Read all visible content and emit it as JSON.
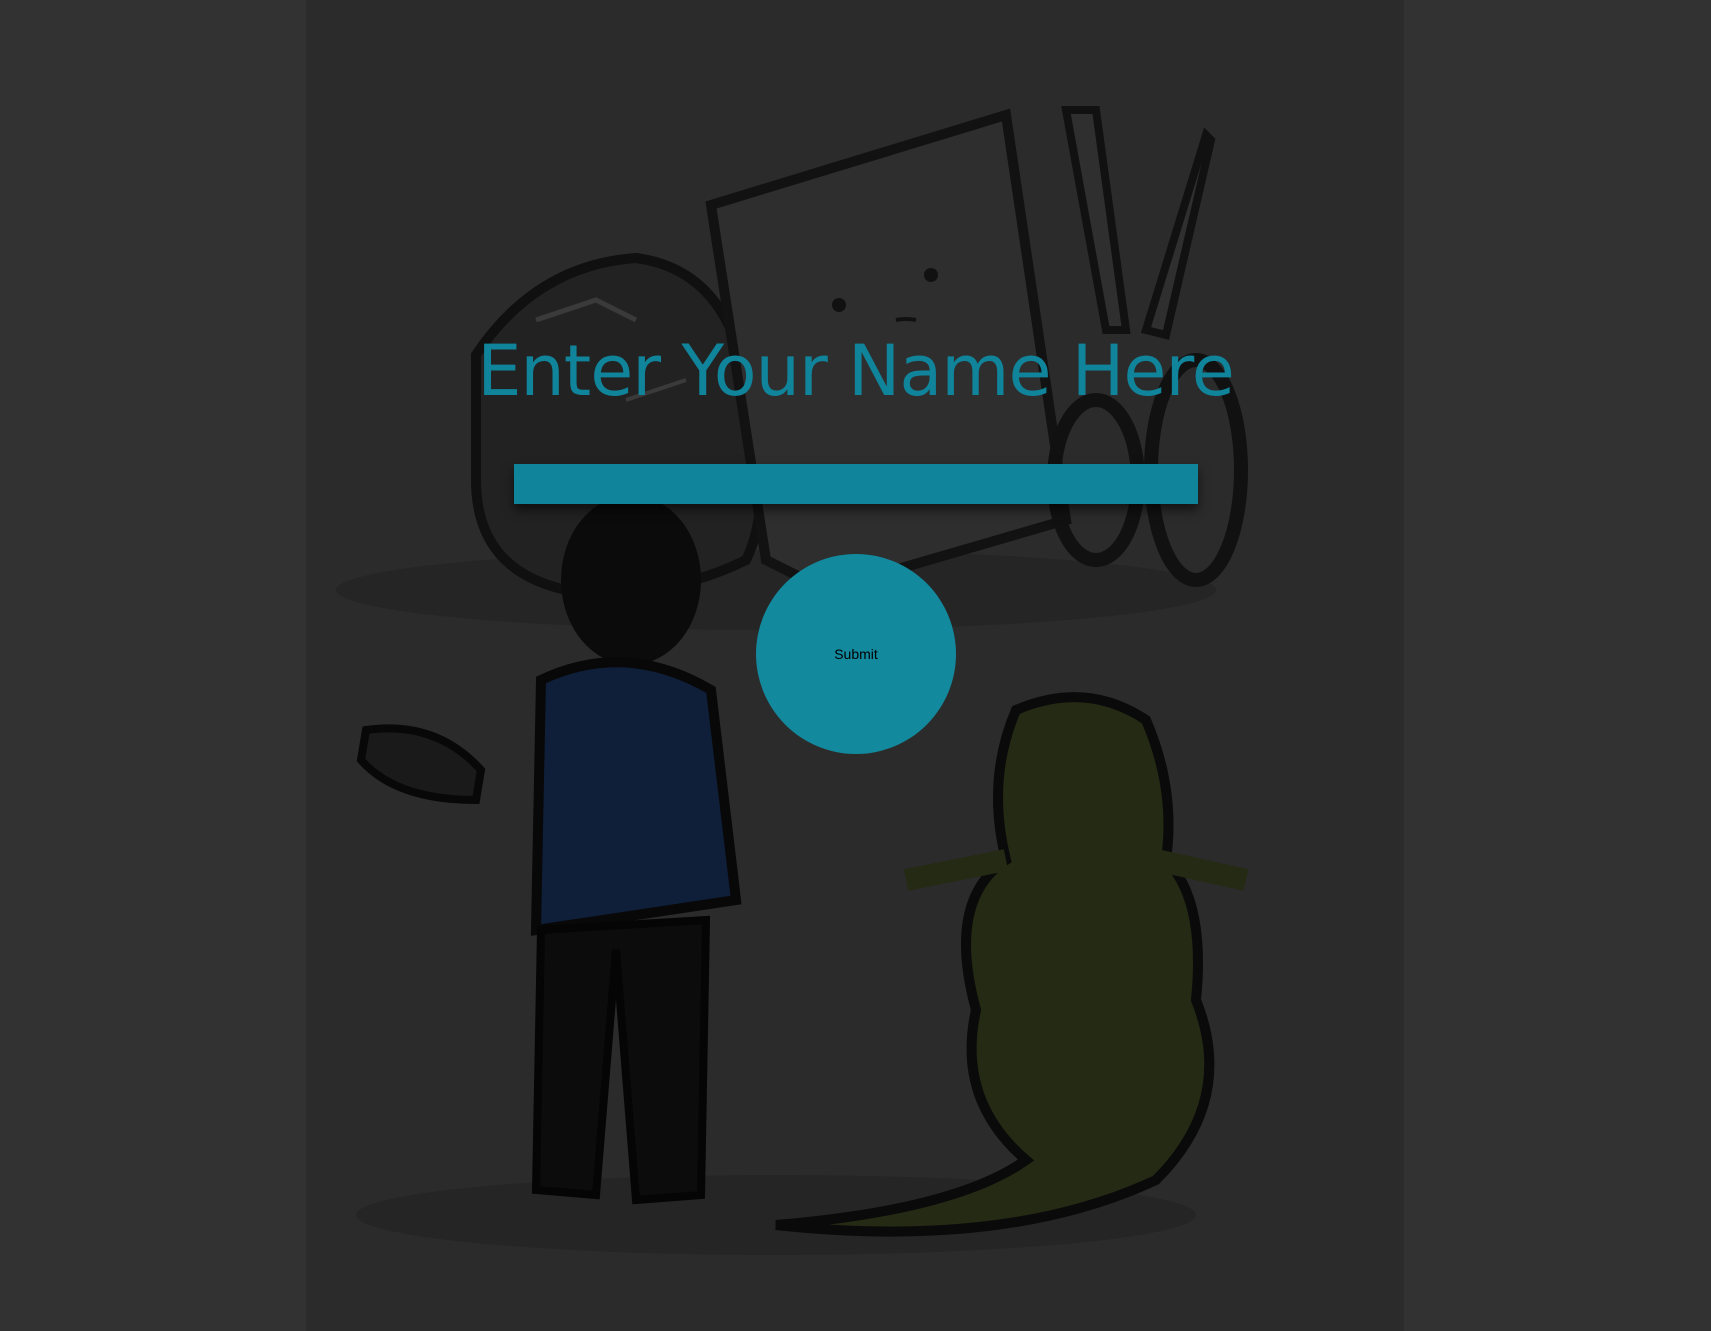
{
  "page": {
    "heading": "Enter Your Name Here"
  },
  "form": {
    "name_value": "",
    "submit_label": "Submit"
  },
  "colors": {
    "accent": "#10849a",
    "button": "#13899e",
    "page_background": "#323232",
    "artwork_background": "#2b2b2b"
  }
}
